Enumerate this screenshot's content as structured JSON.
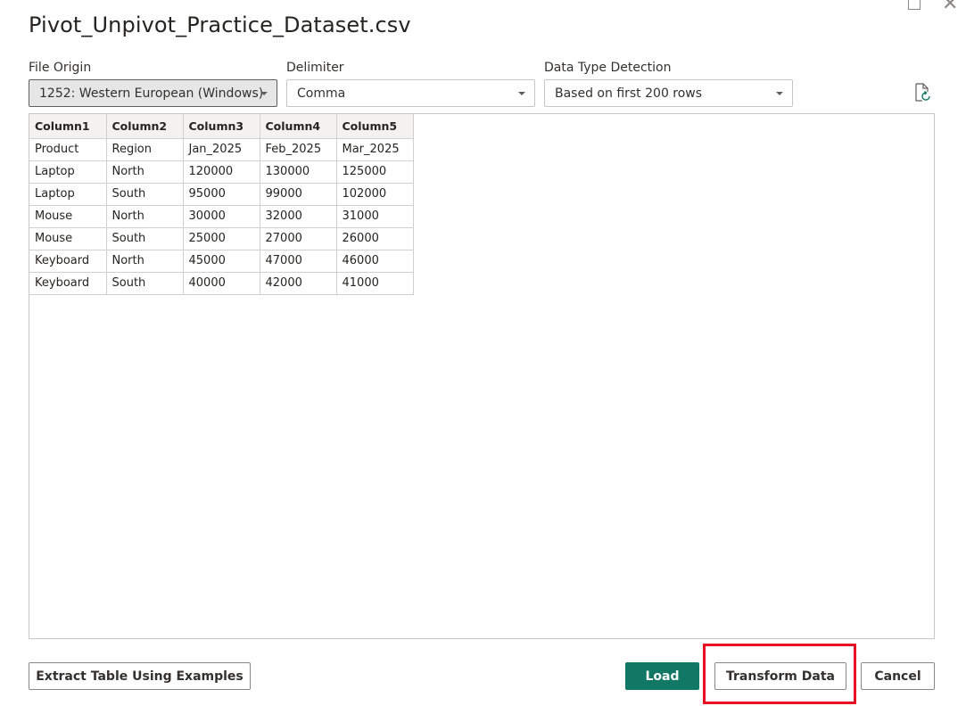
{
  "dialog": {
    "title": "Pivot_Unpivot_Practice_Dataset.csv"
  },
  "settings": {
    "file_origin": {
      "label": "File Origin",
      "value": "1252: Western European (Windows)"
    },
    "delimiter": {
      "label": "Delimiter",
      "value": "Comma"
    },
    "data_type_detection": {
      "label": "Data Type Detection",
      "value": "Based on first 200 rows"
    }
  },
  "preview": {
    "columns": [
      "Column1",
      "Column2",
      "Column3",
      "Column4",
      "Column5"
    ],
    "rows": [
      [
        "Product",
        "Region",
        "Jan_2025",
        "Feb_2025",
        "Mar_2025"
      ],
      [
        "Laptop",
        "North",
        "120000",
        "130000",
        "125000"
      ],
      [
        "Laptop",
        "South",
        "95000",
        "99000",
        "102000"
      ],
      [
        "Mouse",
        "North",
        "30000",
        "32000",
        "31000"
      ],
      [
        "Mouse",
        "South",
        "25000",
        "27000",
        "26000"
      ],
      [
        "Keyboard",
        "North",
        "45000",
        "47000",
        "46000"
      ],
      [
        "Keyboard",
        "South",
        "40000",
        "42000",
        "41000"
      ]
    ]
  },
  "footer": {
    "extract_label": "Extract Table Using Examples",
    "load_label": "Load",
    "transform_label": "Transform Data",
    "cancel_label": "Cancel"
  },
  "colors": {
    "primary_button": "#117865",
    "highlight": "#e81123"
  },
  "icons": {
    "refresh": "refresh-preview-icon",
    "maximize": "maximize-icon",
    "close": "close-icon"
  }
}
